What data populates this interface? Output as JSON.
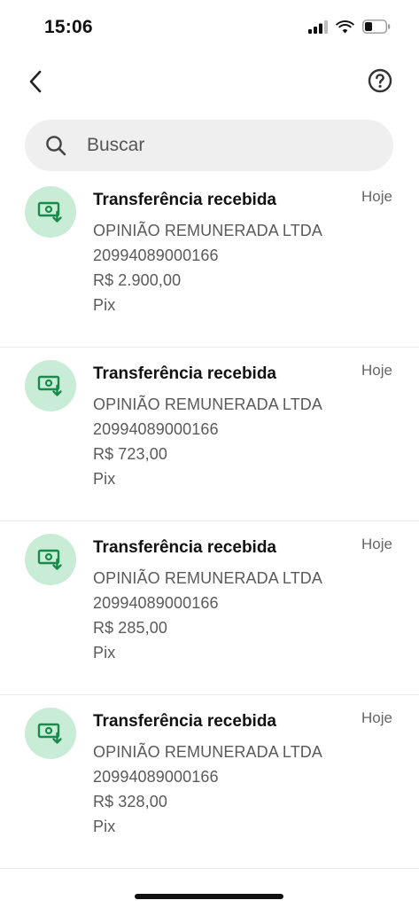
{
  "status_bar": {
    "time": "15:06",
    "icons": [
      "cellular-signal-icon",
      "wifi-icon",
      "battery-icon"
    ]
  },
  "nav": {
    "back_icon": "chevron-left-icon",
    "help_icon": "question-circle-icon"
  },
  "search": {
    "placeholder": "Buscar",
    "value": ""
  },
  "colors": {
    "icon_bg": "#c9ecd6",
    "icon_fg": "#1a8a4a",
    "search_bg": "#efefef"
  },
  "transactions": [
    {
      "title": "Transferência recebida",
      "name": "OPINIÃO REMUNERADA LTDA",
      "document": "20994089000166",
      "amount": "R$ 2.900,00",
      "method": "Pix",
      "date": "Hoje",
      "icon": "money-receive-icon"
    },
    {
      "title": "Transferência recebida",
      "name": "OPINIÃO REMUNERADA LTDA",
      "document": "20994089000166",
      "amount": "R$ 723,00",
      "method": "Pix",
      "date": "Hoje",
      "icon": "money-receive-icon"
    },
    {
      "title": "Transferência recebida",
      "name": "OPINIÃO REMUNERADA LTDA",
      "document": "20994089000166",
      "amount": "R$ 285,00",
      "method": "Pix",
      "date": "Hoje",
      "icon": "money-receive-icon"
    },
    {
      "title": "Transferência recebida",
      "name": "OPINIÃO REMUNERADA LTDA",
      "document": "20994089000166",
      "amount": "R$ 328,00",
      "method": "Pix",
      "date": "Hoje",
      "icon": "money-receive-icon"
    }
  ]
}
